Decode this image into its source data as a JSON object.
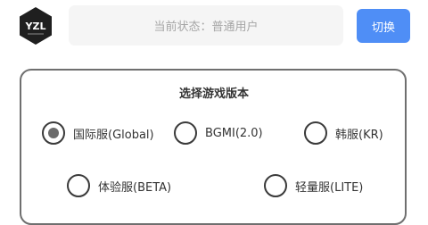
{
  "header": {
    "logo_text": "YZL",
    "status_text": "当前状态：普通用户",
    "switch_label": "切换"
  },
  "version_panel": {
    "title": "选择游戏版本",
    "options": [
      {
        "label": "国际服(Global)",
        "selected": true
      },
      {
        "label": "BGMI(2.0)",
        "selected": false
      },
      {
        "label": "韩服(KR)",
        "selected": false
      },
      {
        "label": "体验服(BETA)",
        "selected": false
      },
      {
        "label": "轻量服(LITE)",
        "selected": false
      }
    ]
  },
  "colors": {
    "accent": "#4f8ef6",
    "field_bg": "#f5f5f5",
    "logo_bg": "#1f1f1f"
  }
}
